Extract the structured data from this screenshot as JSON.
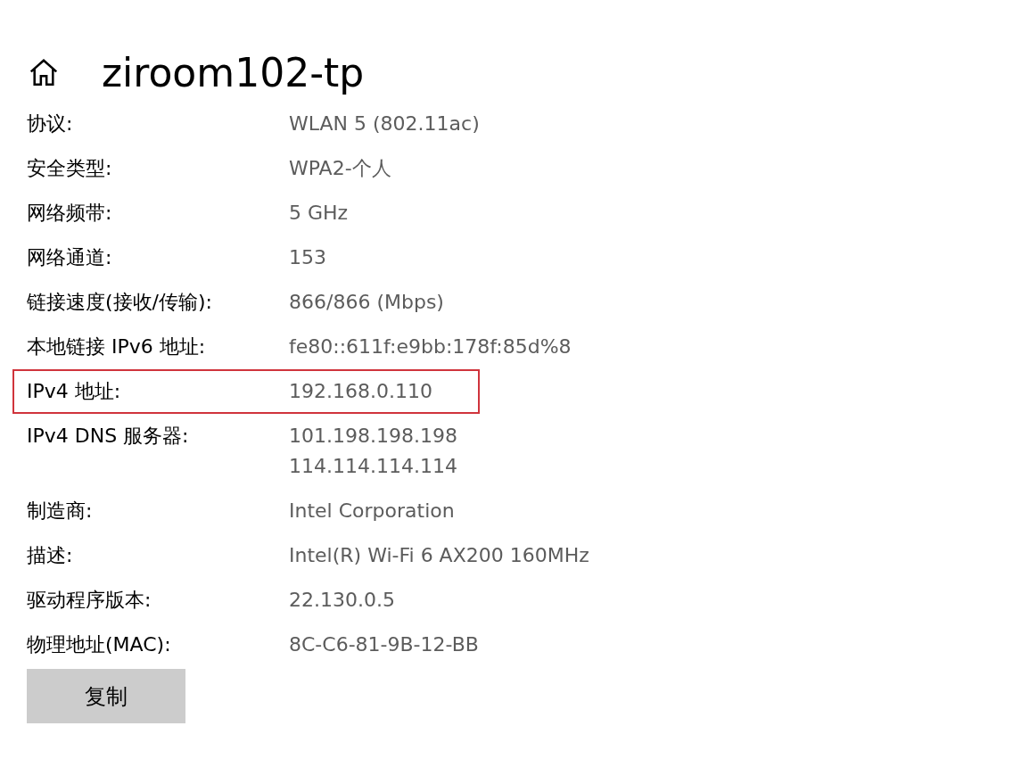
{
  "header": {
    "title": "ziroom102-tp"
  },
  "properties": [
    {
      "label": "协议:",
      "values": [
        "WLAN 5 (802.11ac)"
      ],
      "highlighted": false
    },
    {
      "label": "安全类型:",
      "values": [
        "WPA2-个人"
      ],
      "highlighted": false
    },
    {
      "label": "网络频带:",
      "values": [
        "5 GHz"
      ],
      "highlighted": false
    },
    {
      "label": "网络通道:",
      "values": [
        "153"
      ],
      "highlighted": false
    },
    {
      "label": "链接速度(接收/传输):",
      "values": [
        "866/866 (Mbps)"
      ],
      "highlighted": false
    },
    {
      "label": "本地链接 IPv6 地址:",
      "values": [
        "fe80::611f:e9bb:178f:85d%8"
      ],
      "highlighted": false
    },
    {
      "label": "IPv4 地址:",
      "values": [
        "192.168.0.110"
      ],
      "highlighted": true
    },
    {
      "label": "IPv4 DNS 服务器:",
      "values": [
        "101.198.198.198",
        "114.114.114.114"
      ],
      "highlighted": false
    },
    {
      "label": "制造商:",
      "values": [
        "Intel Corporation"
      ],
      "highlighted": false
    },
    {
      "label": "描述:",
      "values": [
        "Intel(R) Wi-Fi 6 AX200 160MHz"
      ],
      "highlighted": false
    },
    {
      "label": "驱动程序版本:",
      "values": [
        "22.130.0.5"
      ],
      "highlighted": false
    },
    {
      "label": "物理地址(MAC):",
      "values": [
        "8C-C6-81-9B-12-BB"
      ],
      "highlighted": false
    }
  ],
  "copy_button": {
    "label": "复制"
  }
}
